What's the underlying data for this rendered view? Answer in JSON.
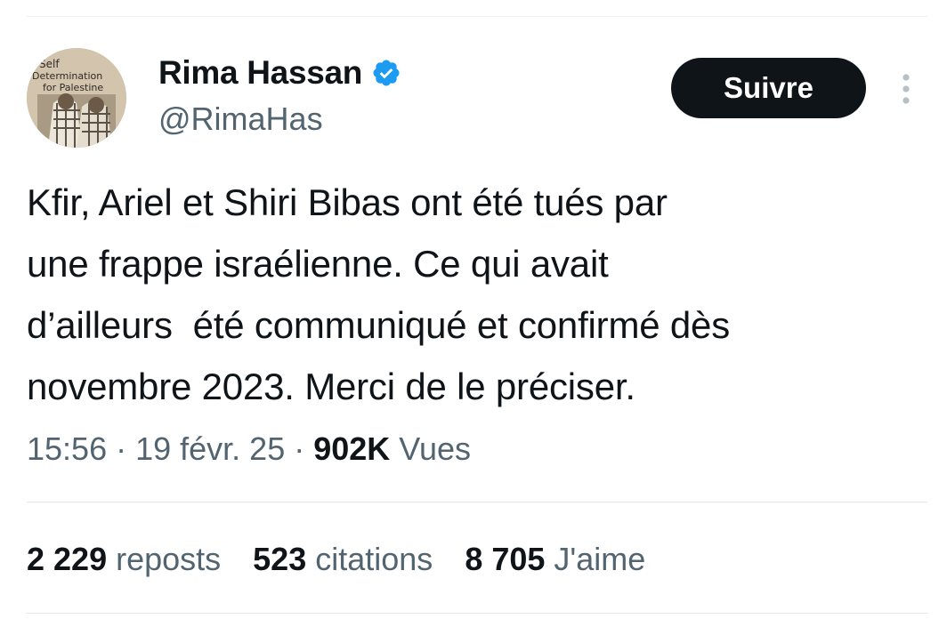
{
  "author": {
    "display_name": "Rima Hassan",
    "handle": "@RimaHas",
    "verified": true,
    "avatar_caption": "Self Determination for Palestine",
    "avatar_caption_lines": [
      "Self",
      "Determination",
      "for Palestine"
    ]
  },
  "follow_button_label": "Suivre",
  "tweet": {
    "text": "Kfir, Ariel et Shiri Bibas ont été tués par\nune frappe israélienne. Ce qui avait\nd’ailleurs  été communiqué et confirmé dès\nnovembre 2023. Merci de le préciser."
  },
  "meta": {
    "time": "15:56",
    "separator": " · ",
    "date": "19 févr. 25",
    "views_count": "902K",
    "views_label": "Vues"
  },
  "stats": {
    "reposts_count": "2 229",
    "reposts_label": "reposts",
    "quotes_count": "523",
    "quotes_label": "citations",
    "likes_count": "8 705",
    "likes_label": "J'aime"
  },
  "colors": {
    "text_primary": "#0f1419",
    "text_secondary": "#536471",
    "verified_blue": "#1d9bf0",
    "button_bg": "#0f1419",
    "divider": "#e1e8ed"
  },
  "icons": {
    "verified": "verified-badge-icon",
    "more": "more-vertical-icon"
  }
}
